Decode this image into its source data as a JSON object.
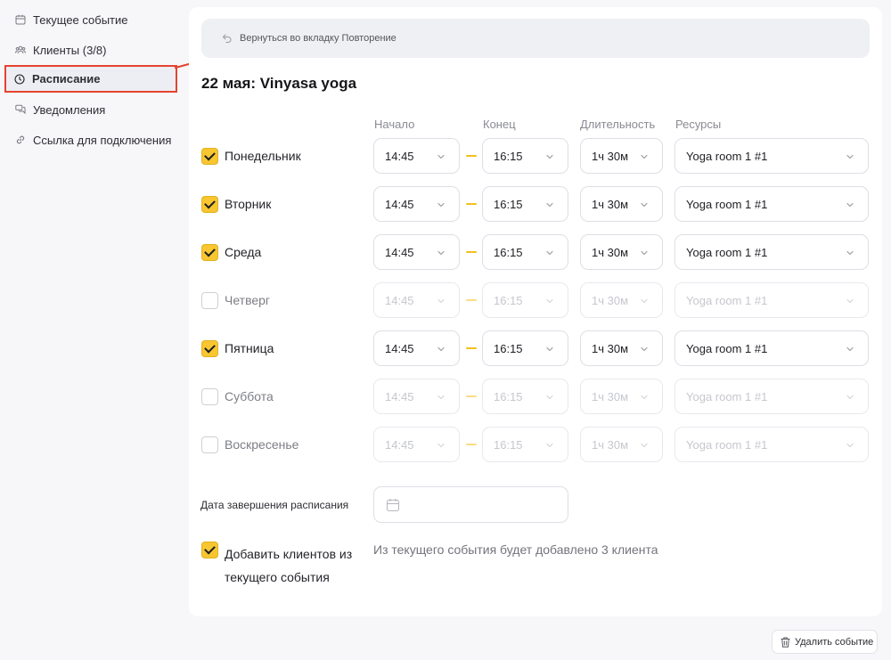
{
  "sidebar": {
    "items": [
      {
        "label": "Текущее событие",
        "icon": "calendar-icon"
      },
      {
        "label": "Клиенты (3/8)",
        "icon": "users-icon"
      },
      {
        "label": "Расписание",
        "icon": "clock-icon",
        "active": true
      },
      {
        "label": "Уведомления",
        "icon": "chat-bubbles-icon"
      },
      {
        "label": "Ссылка для подключения",
        "icon": "link-icon"
      }
    ]
  },
  "back_link": {
    "label": "Вернуться во вкладку Повторение",
    "icon": "return-arrow-icon"
  },
  "title": "22 мая: Vinyasa yoga",
  "columns": {
    "start": "Начало",
    "end": "Конец",
    "duration": "Длительность",
    "resources": "Ресурсы"
  },
  "days": [
    {
      "name": "Понедельник",
      "checked": true,
      "start": "14:45",
      "end": "16:15",
      "duration": "1ч 30м",
      "resource": "Yoga room 1 #1"
    },
    {
      "name": "Вторник",
      "checked": true,
      "start": "14:45",
      "end": "16:15",
      "duration": "1ч 30м",
      "resource": "Yoga room 1 #1"
    },
    {
      "name": "Среда",
      "checked": true,
      "start": "14:45",
      "end": "16:15",
      "duration": "1ч 30м",
      "resource": "Yoga room 1 #1"
    },
    {
      "name": "Четверг",
      "checked": false,
      "start": "14:45",
      "end": "16:15",
      "duration": "1ч 30м",
      "resource": "Yoga room 1 #1"
    },
    {
      "name": "Пятница",
      "checked": true,
      "start": "14:45",
      "end": "16:15",
      "duration": "1ч 30м",
      "resource": "Yoga room 1 #1"
    },
    {
      "name": "Суббота",
      "checked": false,
      "start": "14:45",
      "end": "16:15",
      "duration": "1ч 30м",
      "resource": "Yoga room 1 #1"
    },
    {
      "name": "Воскресенье",
      "checked": false,
      "start": "14:45",
      "end": "16:15",
      "duration": "1ч 30м",
      "resource": "Yoga room 1 #1"
    }
  ],
  "end_date": {
    "label": "Дата завершения расписания",
    "value": "",
    "icon": "calendar-icon"
  },
  "add_clients": {
    "checked": true,
    "label": "Добавить клиентов из текущего события",
    "note": "Из текущего события будет добавлено 3 клиента"
  },
  "delete_button": {
    "label": "Удалить событие",
    "icon": "trash-icon"
  },
  "colors": {
    "accent": "#f7c631",
    "annotation": "#e5432f",
    "background": "#f7f7f9"
  }
}
